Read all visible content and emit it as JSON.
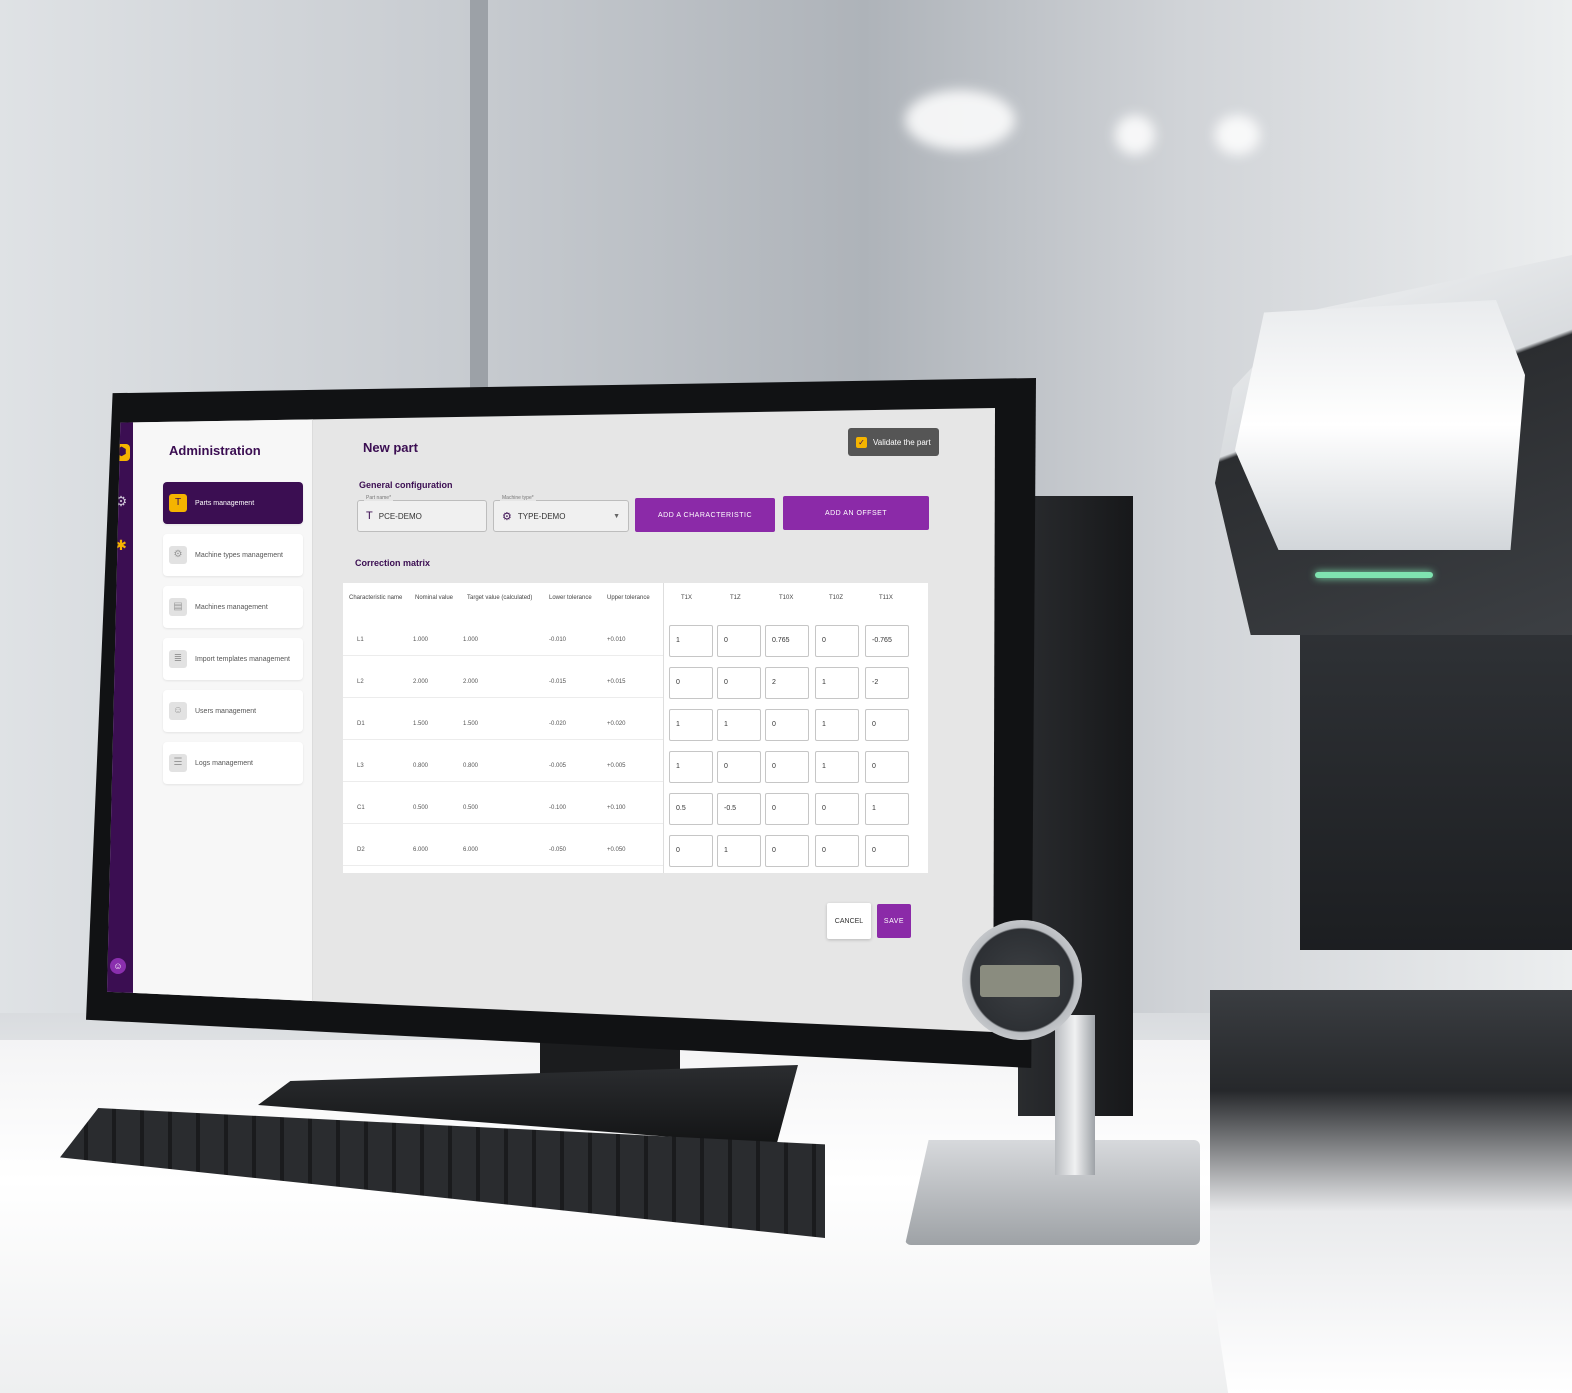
{
  "sidebar": {
    "title": "Administration",
    "items": [
      {
        "label": "Parts management",
        "icon": "part-icon",
        "active": true
      },
      {
        "label": "Machine types management",
        "icon": "machine-type-icon",
        "active": false
      },
      {
        "label": "Machines management",
        "icon": "machine-icon",
        "active": false
      },
      {
        "label": "Import templates management",
        "icon": "import-icon",
        "active": false
      },
      {
        "label": "Users management",
        "icon": "users-icon",
        "active": false
      },
      {
        "label": "Logs management",
        "icon": "logs-icon",
        "active": false
      }
    ]
  },
  "rail": {
    "logo": "logo-icon",
    "icons": [
      "settings-icon",
      "parts-icon",
      "user-icon"
    ]
  },
  "page": {
    "title": "New part",
    "validate_label": "Validate the part",
    "validate_checked": true,
    "general_config_title": "General configuration",
    "part_name_label": "Part name*",
    "part_name_value": "PCE-DEMO",
    "machine_type_label": "Machine type*",
    "machine_type_value": "TYPE-DEMO",
    "add_characteristic_label": "ADD A CHARACTERISTIC",
    "add_offset_label": "ADD AN OFFSET",
    "matrix_title": "Correction matrix",
    "cancel_label": "CANCEL",
    "save_label": "SAVE"
  },
  "matrix": {
    "headers": [
      "Characteristic name",
      "Nominal value",
      "Target value (calculated)",
      "Lower tolerance",
      "Upper tolerance"
    ],
    "offset_headers": [
      "T1X",
      "T1Z",
      "T10X",
      "T10Z",
      "T11X"
    ],
    "rows": [
      {
        "name": "L1",
        "nominal": "1.000",
        "target": "1.000",
        "lower": "-0.010",
        "upper": "+0.010",
        "offsets": [
          "1",
          "0",
          "0.765",
          "0",
          "-0.765"
        ]
      },
      {
        "name": "L2",
        "nominal": "2.000",
        "target": "2.000",
        "lower": "-0.015",
        "upper": "+0.015",
        "offsets": [
          "0",
          "0",
          "2",
          "1",
          "-2"
        ]
      },
      {
        "name": "D1",
        "nominal": "1.500",
        "target": "1.500",
        "lower": "-0.020",
        "upper": "+0.020",
        "offsets": [
          "1",
          "1",
          "0",
          "1",
          "0"
        ]
      },
      {
        "name": "L3",
        "nominal": "0.800",
        "target": "0.800",
        "lower": "-0.005",
        "upper": "+0.005",
        "offsets": [
          "1",
          "0",
          "0",
          "1",
          "0"
        ]
      },
      {
        "name": "C1",
        "nominal": "0.500",
        "target": "0.500",
        "lower": "-0.100",
        "upper": "+0.100",
        "offsets": [
          "0.5",
          "-0.5",
          "0",
          "0",
          "1"
        ]
      },
      {
        "name": "D2",
        "nominal": "6.000",
        "target": "6.000",
        "lower": "-0.050",
        "upper": "+0.050",
        "offsets": [
          "0",
          "1",
          "0",
          "0",
          "0"
        ]
      }
    ]
  },
  "colors": {
    "brand_purple": "#3b0e52",
    "accent_purple": "#8b2aa8",
    "accent_yellow": "#f5b400"
  }
}
